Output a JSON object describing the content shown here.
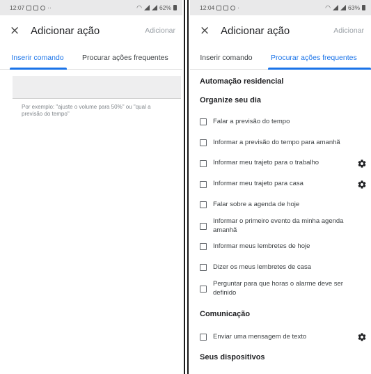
{
  "left": {
    "status": {
      "time": "12:07",
      "battery": "62%"
    },
    "appbar": {
      "close": "×",
      "title": "Adicionar ação",
      "add": "Adicionar"
    },
    "tabs": [
      "Inserir comando",
      "Procurar ações frequentes"
    ],
    "active_tab": 0,
    "input": {
      "value": "",
      "hint": "Por exemplo: \"ajuste o volume para 50%\" ou \"qual a previsão do tempo\""
    }
  },
  "right": {
    "status": {
      "time": "12:04",
      "battery": "63%"
    },
    "appbar": {
      "close": "×",
      "title": "Adicionar ação",
      "add": "Adicionar"
    },
    "tabs": [
      "Inserir comando",
      "Procurar ações frequentes"
    ],
    "active_tab": 1,
    "sections": {
      "home": "Automação residencial",
      "organize": "Organize seu dia",
      "communication": "Comunicação",
      "devices": "Seus dispositivos"
    },
    "organize_items": [
      {
        "label": "Falar a previsão do tempo",
        "checked": false,
        "has_settings": false
      },
      {
        "label": "Informar a previsão do tempo para amanhã",
        "checked": false,
        "has_settings": false
      },
      {
        "label": "Informar meu trajeto para o trabalho",
        "checked": false,
        "has_settings": true
      },
      {
        "label": "Informar meu trajeto para casa",
        "checked": false,
        "has_settings": true
      },
      {
        "label": "Falar sobre a agenda de hoje",
        "checked": false,
        "has_settings": false
      },
      {
        "label": "Informar o primeiro evento da minha agenda amanhã",
        "checked": false,
        "has_settings": false
      },
      {
        "label": "Informar meus lembretes de hoje",
        "checked": false,
        "has_settings": false
      },
      {
        "label": "Dizer os meus lembretes de casa",
        "checked": false,
        "has_settings": false
      },
      {
        "label": "Perguntar para que horas o alarme deve ser definido",
        "checked": false,
        "has_settings": false
      }
    ],
    "communication_items": [
      {
        "label": "Enviar uma mensagem de texto",
        "checked": false,
        "has_settings": true
      }
    ]
  },
  "icons": {
    "close": "close-icon",
    "settings": "gear-icon",
    "checkbox": "checkbox-icon"
  },
  "colors": {
    "accent": "#1a73e8",
    "statusbar": "#e9e9ea",
    "text": "#202124",
    "muted": "#9aa0a6"
  }
}
